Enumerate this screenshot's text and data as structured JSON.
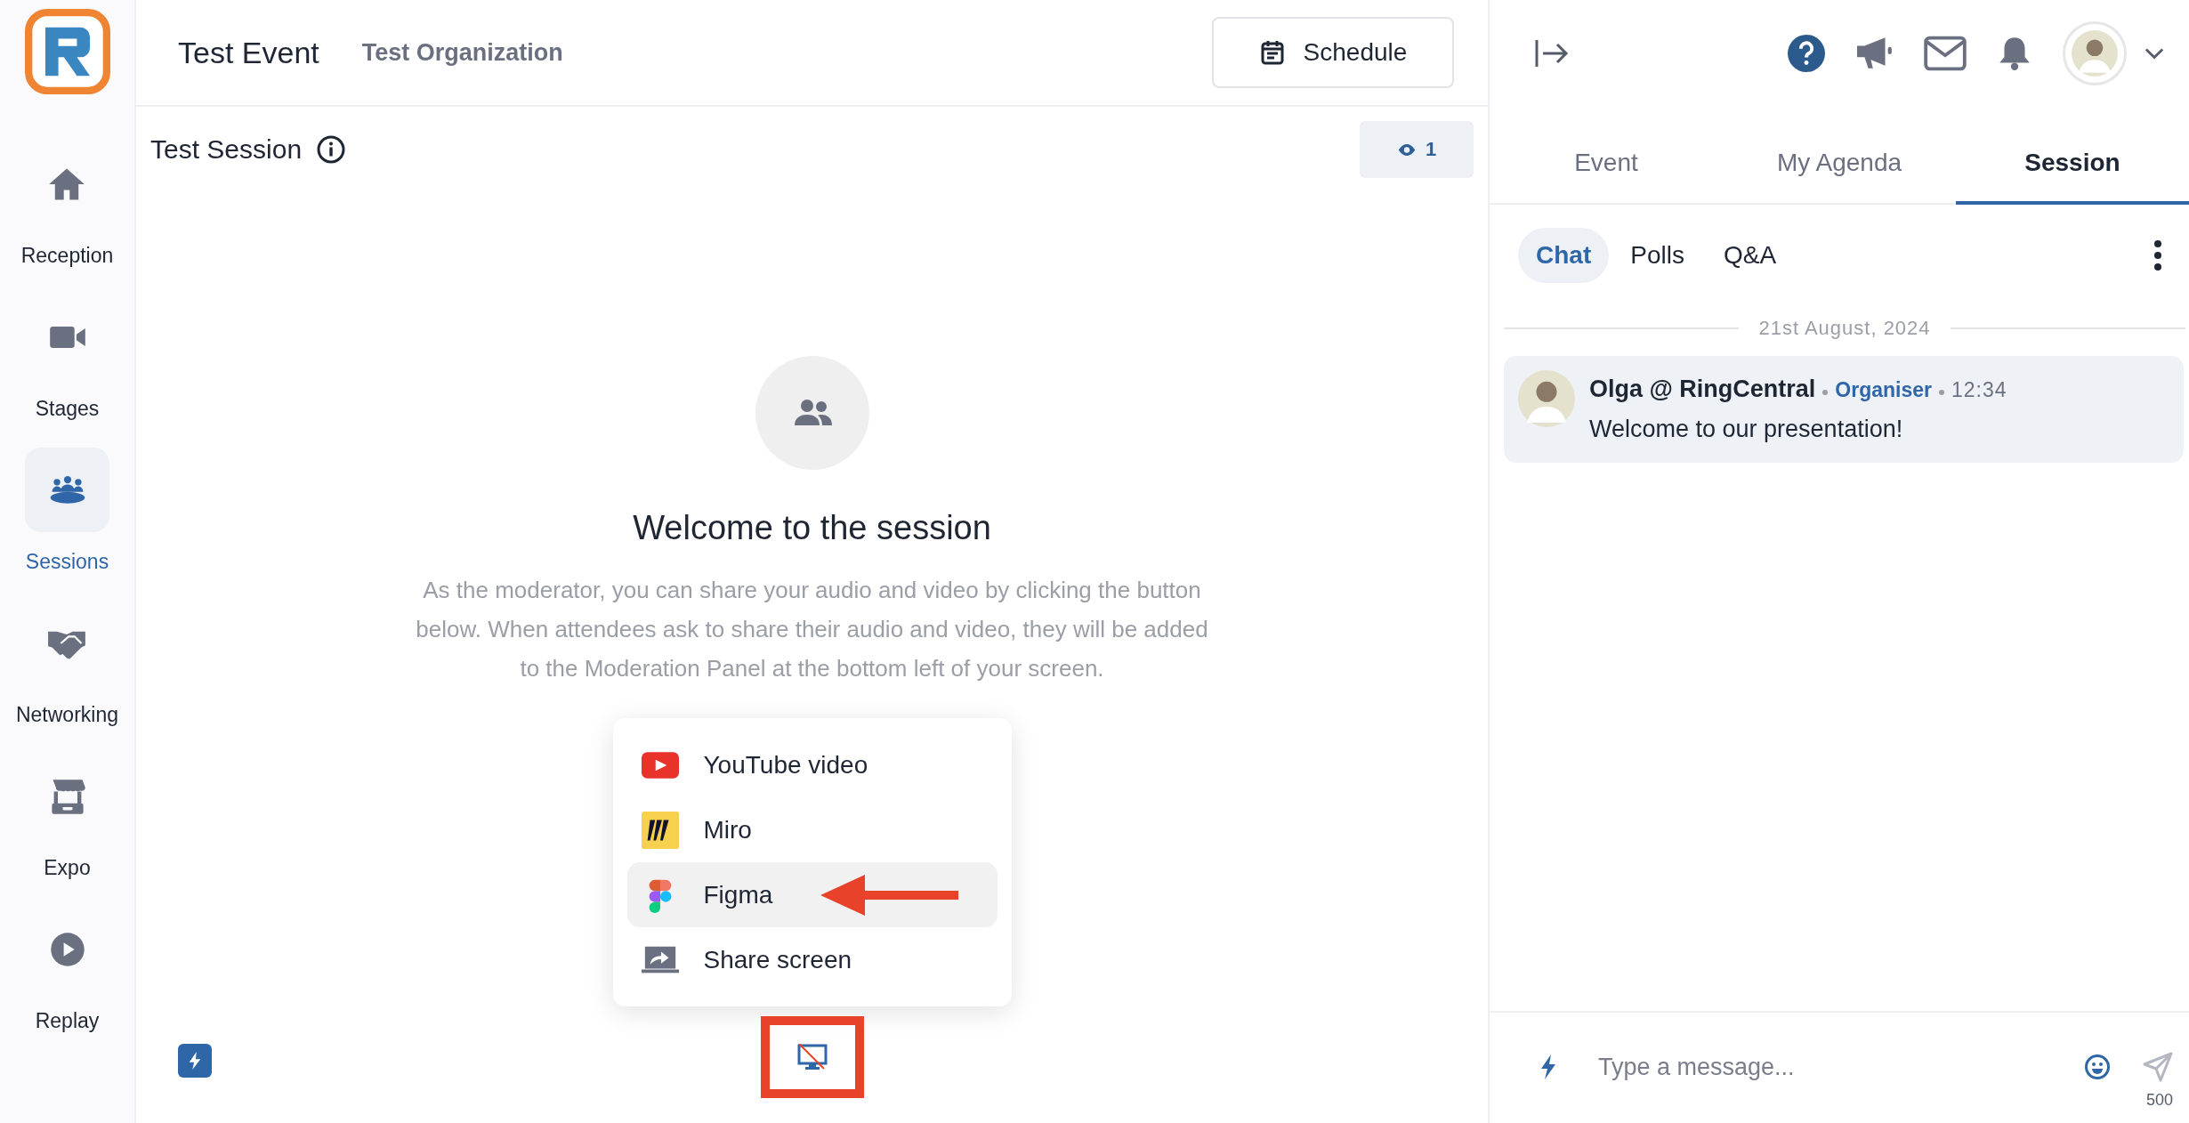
{
  "sidebar": {
    "items": [
      {
        "label": "Reception",
        "kind": "home",
        "selected": false
      },
      {
        "label": "Stages",
        "kind": "video",
        "selected": false
      },
      {
        "label": "Sessions",
        "kind": "sessions",
        "selected": true
      },
      {
        "label": "Networking",
        "kind": "handshake",
        "selected": false
      },
      {
        "label": "Expo",
        "kind": "booth",
        "selected": false
      },
      {
        "label": "Replay",
        "kind": "play",
        "selected": false
      }
    ]
  },
  "header": {
    "title": "Test Event",
    "organization": "Test Organization",
    "schedule_button": "Schedule"
  },
  "session": {
    "title": "Test Session",
    "viewers": "1",
    "welcome_title": "Welcome to the session",
    "welcome_text": "As the moderator, you can share your audio and video by clicking the button below. When attendees ask to share their audio and video, they will be added to the Moderation Panel at the bottom left of your screen.",
    "share_menu": {
      "items": [
        {
          "label": "YouTube video",
          "kind": "youtube",
          "selected": false
        },
        {
          "label": "Miro",
          "kind": "miro",
          "selected": false
        },
        {
          "label": "Figma",
          "kind": "figma",
          "selected": true
        },
        {
          "label": "Share screen",
          "kind": "screen",
          "selected": false
        }
      ]
    }
  },
  "right_panel": {
    "tabs": [
      {
        "label": "Event",
        "selected": false
      },
      {
        "label": "My Agenda",
        "selected": false
      },
      {
        "label": "Session",
        "selected": true
      }
    ],
    "chat_tabs": [
      {
        "label": "Chat",
        "selected": true
      },
      {
        "label": "Polls",
        "selected": false
      },
      {
        "label": "Q&A",
        "selected": false
      }
    ],
    "date": "21st August, 2024",
    "messages": [
      {
        "author": "Olga @ RingCentral",
        "role": "Organiser",
        "time": "12:34",
        "text": "Welcome to our presentation!"
      }
    ],
    "composer": {
      "placeholder": "Type a message...",
      "char_limit": "500"
    }
  }
}
